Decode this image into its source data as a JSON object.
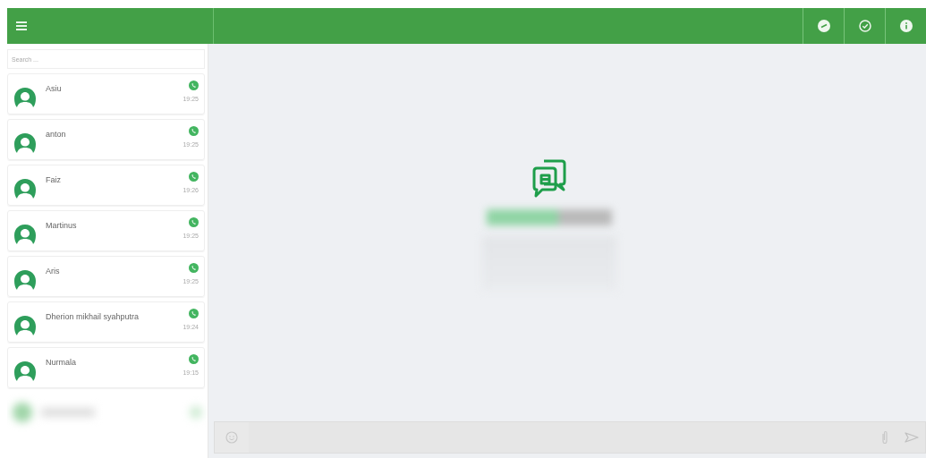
{
  "search": {
    "placeholder": "Search ..."
  },
  "contacts": [
    {
      "name": "Asiu",
      "time": "19:25"
    },
    {
      "name": "anton",
      "time": "19:25"
    },
    {
      "name": "Faiz",
      "time": "19:26"
    },
    {
      "name": "Martinus",
      "time": "19:25"
    },
    {
      "name": "Aris",
      "time": "19:25"
    },
    {
      "name": "Dherion mikhail syahputra",
      "time": "19:24"
    },
    {
      "name": "Nurmala",
      "time": "19:15"
    }
  ]
}
